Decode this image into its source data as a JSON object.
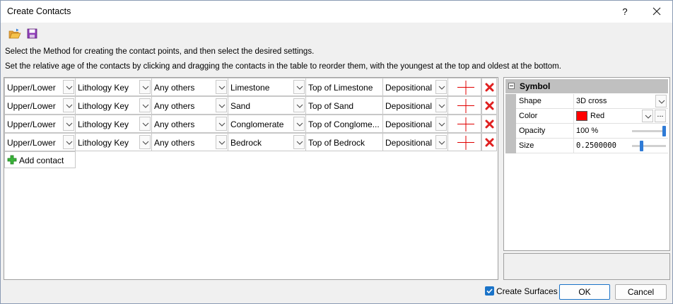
{
  "window": {
    "title": "Create Contacts",
    "help_label": "?",
    "close_label": "✕"
  },
  "toolbar": {
    "open_icon": "folder-open-icon",
    "save_icon": "save-icon"
  },
  "instructions": {
    "line1": "Select the Method for creating the contact points, and then select the desired settings.",
    "line2": "Set the relative age of the contacts by clicking and dragging the contacts in the table to reorder them, with the youngest at the top and oldest at the bottom."
  },
  "contacts": [
    {
      "position": "Upper/Lower",
      "key": "Lithology Key",
      "against": "Any others",
      "unit": "Limestone",
      "name": "Top of Limestone",
      "type": "Depositional"
    },
    {
      "position": "Upper/Lower",
      "key": "Lithology Key",
      "against": "Any others",
      "unit": "Sand",
      "name": "Top of Sand",
      "type": "Depositional"
    },
    {
      "position": "Upper/Lower",
      "key": "Lithology Key",
      "against": "Any others",
      "unit": "Conglomerate",
      "name": "Top of Conglome...",
      "type": "Depositional"
    },
    {
      "position": "Upper/Lower",
      "key": "Lithology Key",
      "against": "Any others",
      "unit": "Bedrock",
      "name": "Top of Bedrock",
      "type": "Depositional"
    }
  ],
  "add_contact_label": "Add contact",
  "symbol_panel": {
    "header": "Symbol",
    "shape_label": "Shape",
    "shape_value": "3D cross",
    "color_label": "Color",
    "color_value": "Red",
    "color_swatch": "#ff0000",
    "color_more": "...",
    "opacity_label": "Opacity",
    "opacity_value": "100 %",
    "opacity_fraction": 1.0,
    "size_label": "Size",
    "size_value": "0.2500000",
    "size_fraction": 0.25
  },
  "footer": {
    "create_surfaces_label": "Create Surfaces",
    "create_surfaces_checked": true,
    "ok_label": "OK",
    "cancel_label": "Cancel"
  },
  "colors": {
    "accent": "#1a73c8",
    "symbol_red": "#e00000",
    "delete_red": "#e02020"
  }
}
